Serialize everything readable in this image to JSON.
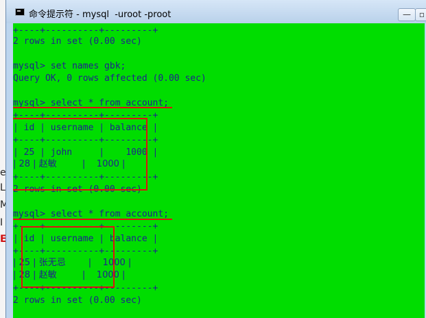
{
  "window": {
    "title": "命令提示符 - mysql  -uroot -proot",
    "minimize_glyph": "—",
    "restore_glyph": "▫"
  },
  "background_app": {
    "fragments": [
      "e",
      "L",
      "M",
      "I",
      "EI"
    ]
  },
  "console": {
    "lines": [
      "+----+----------+---------+",
      "2 rows in set (0.00 sec)",
      "mysql> set names gbk;",
      "Query OK, 0 rows affected (0.00 sec)",
      "mysql> select * from account;",
      "+----+----------+---------+",
      "| id | username | balance |",
      "+----+----------+---------+",
      "| 25 | john     |    1000 |",
      "| 28 | 赵敏         |    1000 |",
      "+----+----------+---------+",
      "2 rows in set (0.00 sec)",
      "mysql> select * from account;",
      "+----+----------+---------+",
      "| id | username | balance |",
      "+----+----------+---------+",
      "| 25 | 张无忌        |    1000 |",
      "| 28 | 赵敏         |    1000 |",
      "+----+----------+---------+",
      "2 rows in set (0.00 sec)"
    ]
  },
  "colors": {
    "console_bg": "#00dd00",
    "console_text": "#1f1f8f",
    "annotation": "#e01010",
    "titlebar": "#c8dcf0"
  }
}
